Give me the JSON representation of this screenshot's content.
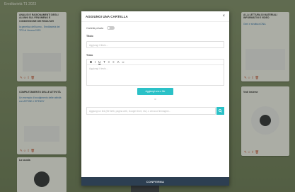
{
  "board": {
    "title": "Ereditarietà T1 2023",
    "left_cards": [
      {
        "heading": "ANALISI E RAGIONAMENTI DEGLI ALUNNI SUL FENOMENO E CONDIVISIONE DEI RISULTATI",
        "link": "la genetica dell'uomo - Ereditarietà dei TPS di Verona 2023",
        "actions": "✎ ☆ ⇧ 🗑"
      },
      {
        "heading": "COMPLETAMENTO DELLE ATTIVITÀ",
        "link": "Un esempio di svolgimento delle attività con AFFINE e SPENSY",
        "actions": "✎ ☆ ⇧ 🗑"
      },
      {
        "heading": "La scuola",
        "actions": ""
      }
    ],
    "right_cards": [
      {
        "heading": "A LA LETTURA DI MATERIALI INFORMATIVI E VIDEO",
        "link": "Geni e struttura DNA",
        "actions": "✎ ☆ ⇧ 🗑"
      },
      {
        "heading": "Vedi insieme",
        "actions": "✎ ☆ ⇧ 🗑"
      }
    ]
  },
  "modal": {
    "title": "AGGIUNGI UNA CARTELLA",
    "close": "×",
    "private_label": "Cartella privata",
    "title_label": "Titolo",
    "title_placeholder": "Aggiungi il titolo...",
    "text_label": "Testo",
    "toolbar": [
      "B",
      "I",
      "U",
      "T",
      "≡",
      "≡",
      "A",
      "∞"
    ],
    "text_placeholder": "Aggiungi il testo...",
    "upload_label": "Aggiungi uno o file",
    "or_label": "o",
    "link_placeholder": "Aggiungi un link (file Web, pagina web, Google Drive, etc.) o cerca un'immagine...",
    "submit_label": "CONFERMA"
  },
  "colors": {
    "accent": "#2bc1c7",
    "footer": "#2d3f52",
    "board": "#6e7d57"
  }
}
